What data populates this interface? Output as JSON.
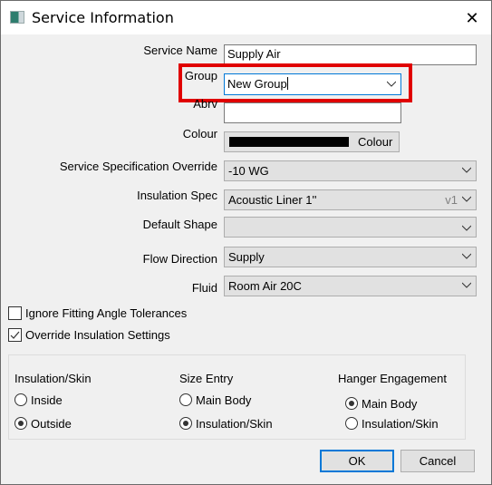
{
  "window": {
    "title": "Service Information",
    "icon": "app-window-icon",
    "close_icon": "close-icon"
  },
  "fields": {
    "service_name": {
      "label": "Service Name",
      "value": "Supply Air"
    },
    "group": {
      "label": "Group",
      "value": "New Group"
    },
    "abrv": {
      "label": "Abrv",
      "value": ""
    },
    "colour": {
      "label": "Colour",
      "button_label": "Colour",
      "swatch_color": "#000000"
    },
    "spec_override": {
      "label": "Service Specification Override",
      "value": "-10 WG"
    },
    "insulation_spec": {
      "label": "Insulation Spec",
      "value": "Acoustic Liner 1''",
      "version": "v1"
    },
    "default_shape": {
      "label": "Default Shape",
      "value": ""
    },
    "flow_direction": {
      "label": "Flow Direction",
      "value": "Supply"
    },
    "fluid": {
      "label": "Fluid",
      "value": "Room Air 20C"
    }
  },
  "checkboxes": {
    "ignore_fitting": {
      "label": "Ignore Fitting Angle Tolerances",
      "checked": false
    },
    "override_insulation": {
      "label": "Override Insulation Settings",
      "checked": true
    }
  },
  "options": {
    "insulation_skin": {
      "title": "Insulation/Skin",
      "items": [
        {
          "label": "Inside",
          "selected": false
        },
        {
          "label": "Outside",
          "selected": true
        }
      ]
    },
    "size_entry": {
      "title": "Size Entry",
      "items": [
        {
          "label": "Main Body",
          "selected": false
        },
        {
          "label": "Insulation/Skin",
          "selected": true
        }
      ]
    },
    "hanger_engagement": {
      "title": "Hanger Engagement",
      "items": [
        {
          "label": "Main Body",
          "selected": true
        },
        {
          "label": "Insulation/Skin",
          "selected": false
        }
      ]
    }
  },
  "buttons": {
    "ok": "OK",
    "cancel": "Cancel"
  },
  "highlight": {
    "color": "#e00000",
    "target": "group"
  }
}
